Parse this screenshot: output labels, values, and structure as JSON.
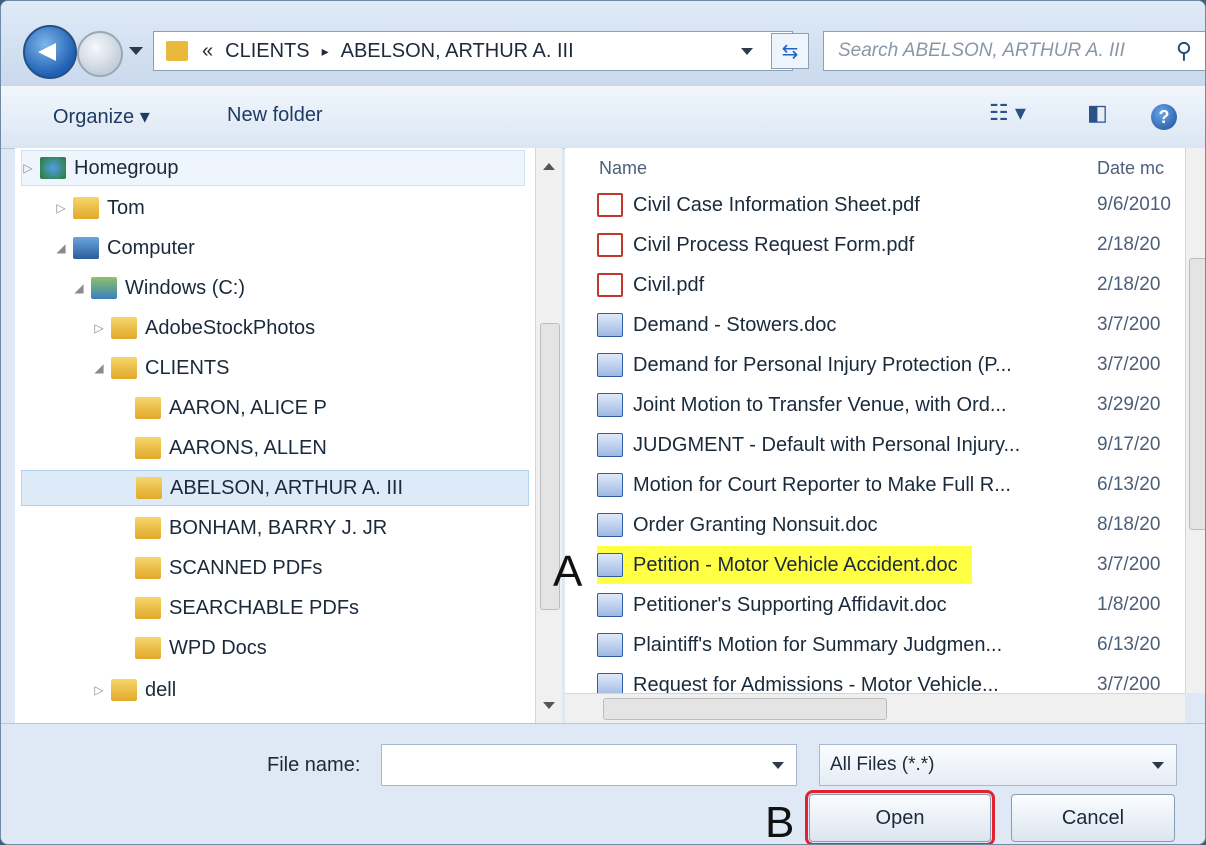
{
  "address": {
    "overflow": "«",
    "crumbs": [
      "CLIENTS",
      "ABELSON, ARTHUR A. III"
    ],
    "separator": "▸"
  },
  "search": {
    "placeholder": "Search ABELSON, ARTHUR A. III"
  },
  "toolbar": {
    "organize_label": "Organize ▾",
    "new_folder_label": "New folder"
  },
  "nav_tree": [
    {
      "label": "Homegroup",
      "arrow": "▷",
      "icon": "homegroup-icon"
    },
    {
      "label": "Tom",
      "arrow": "▷",
      "icon": "user-folder-icon"
    },
    {
      "label": "Computer",
      "arrow": "◢",
      "icon": "computer-icon"
    },
    {
      "label": "Windows (C:)",
      "arrow": "◢",
      "icon": "drive-icon"
    },
    {
      "label": "AdobeStockPhotos",
      "arrow": "▷",
      "icon": "folder-icon"
    },
    {
      "label": "CLIENTS",
      "arrow": "◢",
      "icon": "folder-icon"
    },
    {
      "label": "AARON, ALICE P",
      "arrow": "",
      "icon": "folder-icon"
    },
    {
      "label": "AARONS, ALLEN",
      "arrow": "",
      "icon": "folder-icon"
    },
    {
      "label": "ABELSON, ARTHUR A. III",
      "arrow": "",
      "icon": "folder-icon"
    },
    {
      "label": "BONHAM, BARRY J. JR",
      "arrow": "",
      "icon": "folder-icon"
    },
    {
      "label": "SCANNED PDFs",
      "arrow": "",
      "icon": "folder-icon"
    },
    {
      "label": "SEARCHABLE PDFs",
      "arrow": "",
      "icon": "folder-icon"
    },
    {
      "label": "WPD Docs",
      "arrow": "",
      "icon": "folder-icon"
    },
    {
      "label": "dell",
      "arrow": "▷",
      "icon": "folder-icon"
    }
  ],
  "columns": {
    "name": "Name",
    "date": "Date mc"
  },
  "files": [
    {
      "name": "Civil Case Information Sheet.pdf",
      "date": "9/6/2010",
      "type": "pdf"
    },
    {
      "name": "Civil Process Request Form.pdf",
      "date": "2/18/20",
      "type": "pdf"
    },
    {
      "name": "Civil.pdf",
      "date": "2/18/20",
      "type": "pdf"
    },
    {
      "name": "Demand - Stowers.doc",
      "date": "3/7/200",
      "type": "doc"
    },
    {
      "name": "Demand for Personal Injury Protection (P...",
      "date": "3/7/200",
      "type": "doc"
    },
    {
      "name": "Joint Motion to Transfer Venue, with Ord...",
      "date": "3/29/20",
      "type": "doc"
    },
    {
      "name": "JUDGMENT - Default with Personal Injury...",
      "date": "9/17/20",
      "type": "doc"
    },
    {
      "name": "Motion for Court Reporter to Make Full R...",
      "date": "6/13/20",
      "type": "doc"
    },
    {
      "name": "Order Granting Nonsuit.doc",
      "date": "8/18/20",
      "type": "doc"
    },
    {
      "name": "Petition - Motor Vehicle Accident.doc",
      "date": "3/7/200",
      "type": "doc"
    },
    {
      "name": "Petitioner's Supporting Affidavit.doc",
      "date": "1/8/200",
      "type": "doc"
    },
    {
      "name": "Plaintiff's Motion for Summary Judgmen...",
      "date": "6/13/20",
      "type": "doc"
    },
    {
      "name": "Request for Admissions - Motor Vehicle...",
      "date": "3/7/200",
      "type": "doc"
    }
  ],
  "bottom": {
    "filename_label": "File name:",
    "filename_value": "",
    "filter_value": "All Files (*.*)",
    "open_label": "Open",
    "cancel_label": "Cancel"
  },
  "markers": {
    "a": "A",
    "b": "B"
  },
  "colors": {
    "highlight": "#ffff44",
    "open_outline": "#e0232f"
  }
}
